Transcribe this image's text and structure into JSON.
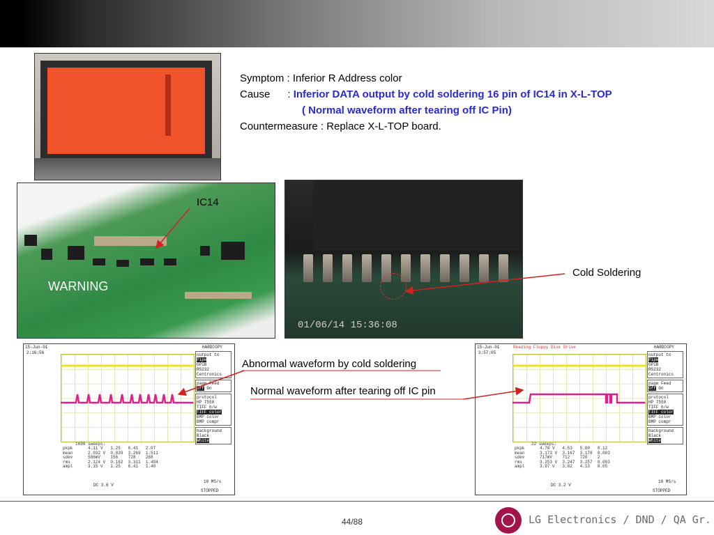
{
  "symptom": {
    "line1": "Symptom : Inferior R Address color",
    "cause_prefix": "Cause      : ",
    "cause_text": "Inferior DATA output by cold soldering 16 pin of IC14 in  X-L-TOP",
    "cause_note": "( Normal waveform after tearing off IC Pin)",
    "countermeasure": "Countermeasure :  Replace X-L-TOP board."
  },
  "labels": {
    "ic14": "IC14",
    "cold_soldering": "Cold Soldering",
    "abnormal": "Abnormal waveform by cold soldering",
    "normal": "Normal waveform after tearing off IC pin"
  },
  "photos": {
    "pcb_warning": "WARNING",
    "macro_timestamp": "01/06/14 15:36:08"
  },
  "scope_left": {
    "date": "15-Jun-01",
    "time": "2:16:56",
    "header": "",
    "hardcopy": "HARDCOPY",
    "sweeps": "1699 sweeps:",
    "stats_rows": [
      "pkpk      4.11 V   1.25   6.41   2.07",
      "mean      2.032 V  0.839  3.269  1.511",
      "sdev      586mV    156    728    268",
      "rms       2.124 V  0.162  3.311  1.494",
      "ampl      3.15 V   1.25   6.41   1.40"
    ],
    "timebase": "10 MS/s",
    "status": "STOPPED",
    "dc": "DC 3.6 V"
  },
  "scope_right": {
    "date": "15-Jun-01",
    "time": "3:57:05",
    "header": "Reading Floppy Disk Drive",
    "hardcopy": "HARDCOPY",
    "sweeps": "22 sweeps:",
    "stats_rows": [
      "pkpk      4.76 V   4.53   5.00   0.12",
      "mean      3.173 V  3.167  3.178  0.003",
      "sdev      717mV    712    720    2",
      "rms       3.253 V  3.247  3.257  0.003",
      "ampl      3.97 V   3.82   4.13   0.05"
    ],
    "timebase": "10 MS/s",
    "status": "STOPPED",
    "dc": "DC 3.2 V"
  },
  "footer": {
    "page": "44/88",
    "company": "LG Electronics / DND / QA Gr."
  },
  "colors": {
    "yellow_trace": "#f0e21a",
    "magenta_trace": "#e0208a",
    "arrow": "#d42020",
    "logo": "#a3154a",
    "cause_blue": "#2a2ad4"
  }
}
